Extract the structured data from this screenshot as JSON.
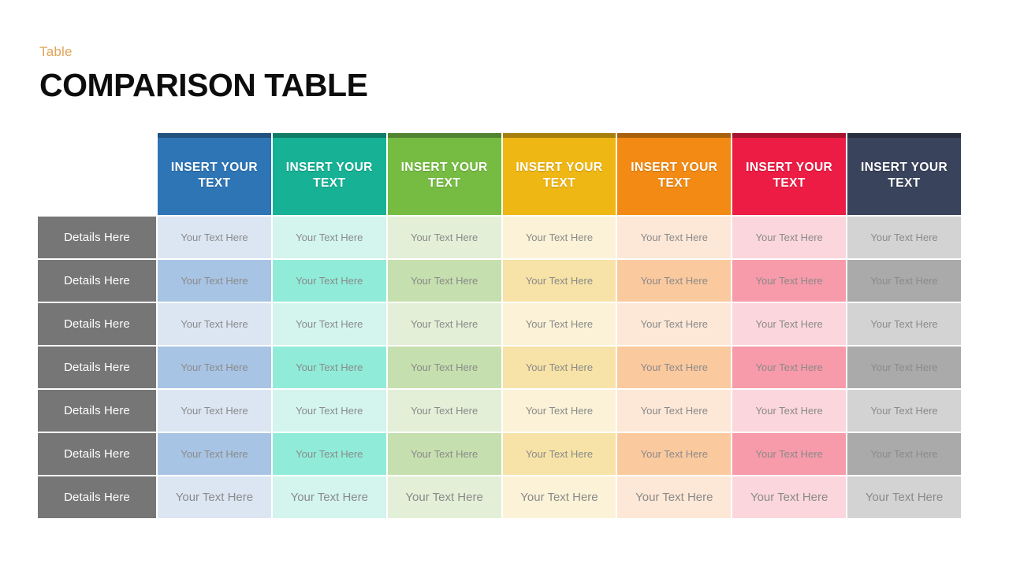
{
  "header": {
    "eyebrow": "Table",
    "title": "COMPARISON TABLE"
  },
  "table": {
    "corner_label": "",
    "columns": [
      {
        "label": "INSERT YOUR TEXT",
        "header_color": "#2E75B6",
        "tint_light": "#dce6f3",
        "tint_dark": "#a8c4e4"
      },
      {
        "label": "INSERT YOUR TEXT",
        "header_color": "#17B296",
        "tint_light": "#d3f5ee",
        "tint_dark": "#90ecd9"
      },
      {
        "label": "INSERT YOUR TEXT",
        "header_color": "#76BC43",
        "tint_light": "#e3efd7",
        "tint_dark": "#c6dfae"
      },
      {
        "label": "INSERT YOUR TEXT",
        "header_color": "#EFB714",
        "tint_light": "#fbf2d7",
        "tint_dark": "#f7e3a7"
      },
      {
        "label": "INSERT YOUR TEXT",
        "header_color": "#F28A14",
        "tint_light": "#fde7d6",
        "tint_dark": "#fbc99e"
      },
      {
        "label": "INSERT YOUR TEXT",
        "header_color": "#ED1C45",
        "tint_light": "#fbd6dd",
        "tint_dark": "#f79aaa"
      },
      {
        "label": "INSERT YOUR TEXT",
        "header_color": "#3A435C",
        "tint_light": "#d3d3d3",
        "tint_dark": "#aaaaaa"
      }
    ],
    "rows": [
      {
        "label": "Details Here",
        "shade": "light",
        "cells": [
          "Your Text Here",
          "Your Text Here",
          "Your Text Here",
          "Your Text Here",
          "Your Text Here",
          "Your Text Here",
          "Your Text Here"
        ]
      },
      {
        "label": "Details Here",
        "shade": "dark",
        "cells": [
          "Your Text Here",
          "Your Text Here",
          "Your Text Here",
          "Your Text Here",
          "Your Text Here",
          "Your Text Here",
          "Your Text Here"
        ]
      },
      {
        "label": "Details Here",
        "shade": "light",
        "cells": [
          "Your Text Here",
          "Your Text Here",
          "Your Text Here",
          "Your Text Here",
          "Your Text Here",
          "Your Text Here",
          "Your Text Here"
        ]
      },
      {
        "label": "Details Here",
        "shade": "dark",
        "cells": [
          "Your Text Here",
          "Your Text Here",
          "Your Text Here",
          "Your Text Here",
          "Your Text Here",
          "Your Text Here",
          "Your Text Here"
        ]
      },
      {
        "label": "Details Here",
        "shade": "light",
        "cells": [
          "Your Text Here",
          "Your Text Here",
          "Your Text Here",
          "Your Text Here",
          "Your Text Here",
          "Your Text Here",
          "Your Text Here"
        ]
      },
      {
        "label": "Details Here",
        "shade": "dark",
        "cells": [
          "Your Text Here",
          "Your Text Here",
          "Your Text Here",
          "Your Text Here",
          "Your Text Here",
          "Your Text Here",
          "Your Text Here"
        ]
      },
      {
        "label": "Details Here",
        "shade": "light",
        "cells": [
          "Your Text Here",
          "Your Text Here",
          "Your Text Here",
          "Your Text Here",
          "Your Text Here",
          "Your Text Here",
          "Your Text Here"
        ]
      }
    ],
    "row_label_color": "#767676",
    "cell_text_color": "#8a8a8a"
  }
}
